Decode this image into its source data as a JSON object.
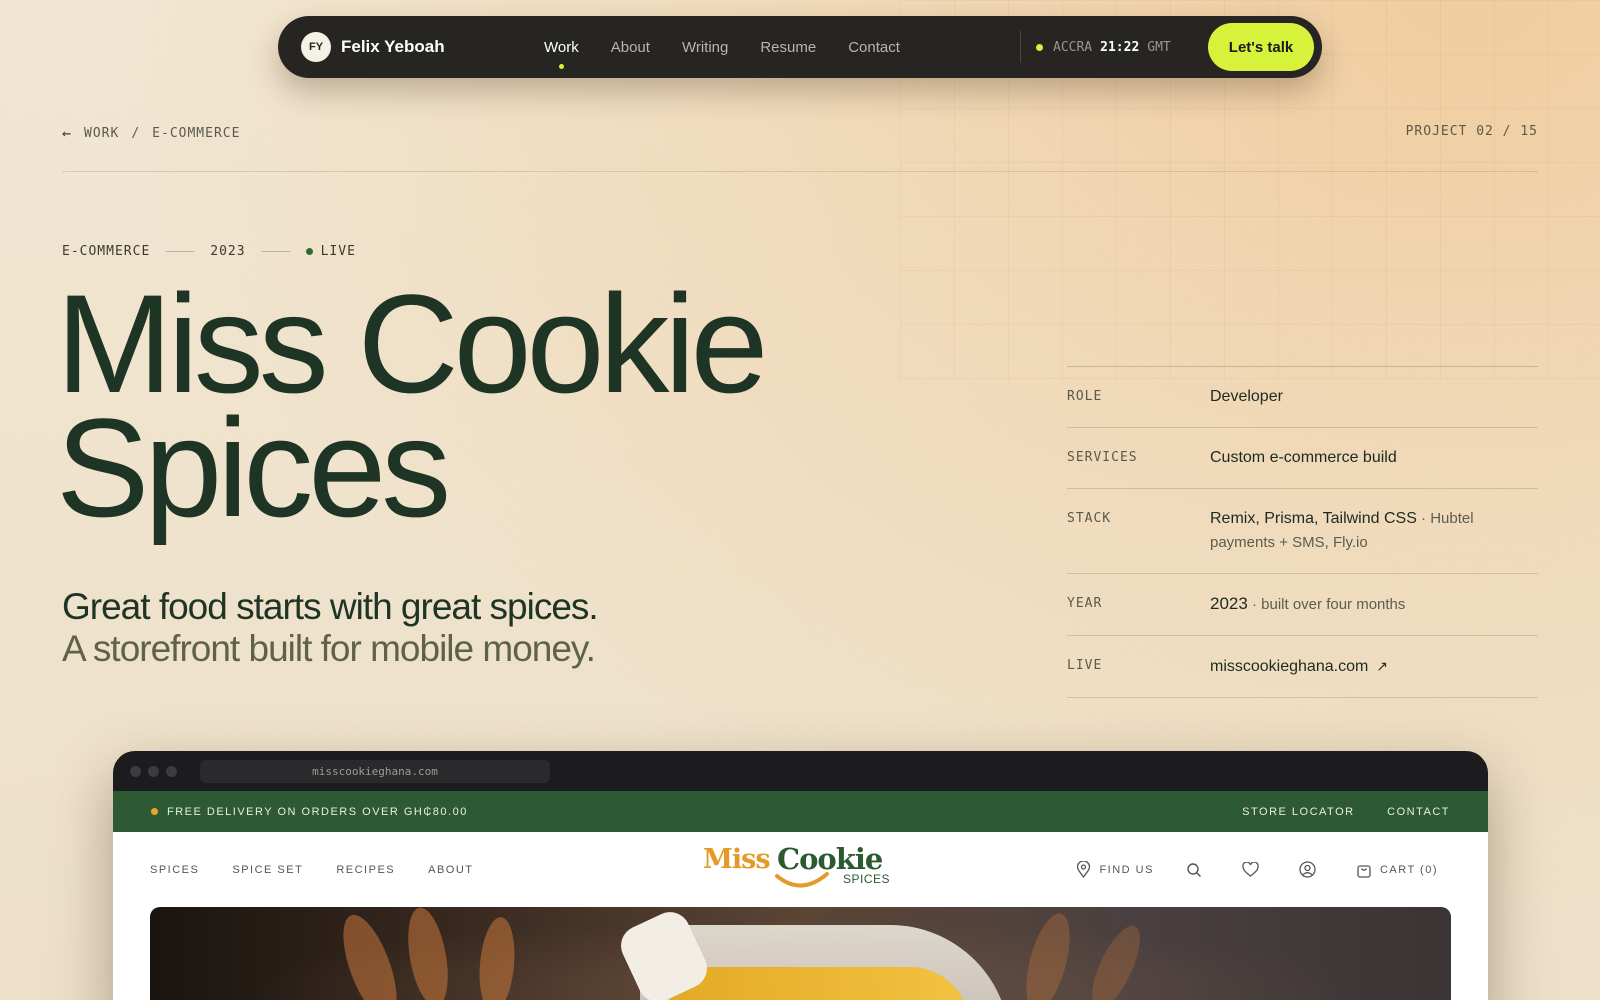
{
  "nav": {
    "initials": "FY",
    "name": "Felix Yeboah",
    "links": [
      "Work",
      "About",
      "Writing",
      "Resume",
      "Contact"
    ],
    "active": "Work",
    "city": "ACCRA",
    "time": "21:22",
    "tz": "GMT",
    "cta": "Let's talk"
  },
  "breadcrumb": {
    "root": "WORK",
    "separator": "/",
    "current": "E-COMMERCE",
    "project_counter": "PROJECT 02 / 15"
  },
  "meta": {
    "category": "E-COMMERCE",
    "year": "2023",
    "status": "LIVE"
  },
  "title": {
    "line1": "Miss Cookie",
    "line2": "Spices"
  },
  "tagline": {
    "line1": "Great food starts with great spices.",
    "line2": "A storefront built for mobile money."
  },
  "details": {
    "role_label": "ROLE",
    "role": "Developer",
    "services_label": "SERVICES",
    "services": "Custom e-commerce build",
    "stack_label": "STACK",
    "stack_main": "Remix, Prisma, Tailwind CSS",
    "stack_sub": " · Hubtel payments + SMS, Fly.io",
    "year_label": "YEAR",
    "year": "2023",
    "year_sub": " · built over four months",
    "live_label": "LIVE",
    "live_url": "misscookieghana.com",
    "live_arrow": "↗"
  },
  "browser": {
    "url": "misscookieghana.com"
  },
  "site": {
    "announcement": "FREE DELIVERY ON ORDERS OVER GH₵80.00",
    "top_links": [
      "STORE LOCATOR",
      "CONTACT"
    ],
    "nav_links": [
      "SPICES",
      "SPICE SET",
      "RECIPES",
      "ABOUT"
    ],
    "logo_miss": "Miss",
    "logo_cookie": "Cookie",
    "logo_spices": "SPICES",
    "find_us": "FIND US",
    "cart": "CART (0)"
  },
  "colors": {
    "accent": "#d7f23b",
    "title": "#1e3424",
    "site_green": "#2e5a33",
    "logo_orange": "#e39a26"
  }
}
